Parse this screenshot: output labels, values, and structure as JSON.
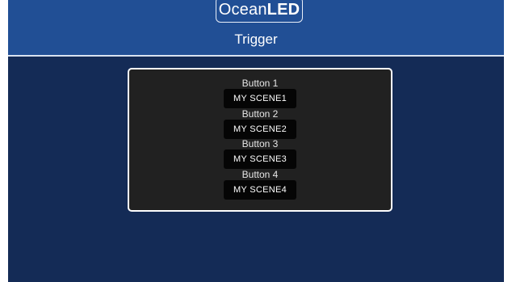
{
  "header": {
    "logo_ocean": "Ocean",
    "logo_led": "LED",
    "title": "Trigger"
  },
  "triggers": [
    {
      "label": "Button 1",
      "scene": "MY SCENE1"
    },
    {
      "label": "Button 2",
      "scene": "MY SCENE2"
    },
    {
      "label": "Button 3",
      "scene": "MY SCENE3"
    },
    {
      "label": "Button 4",
      "scene": "MY SCENE4"
    }
  ],
  "colors": {
    "header_bg": "#214f95",
    "page_bg": "#142b56",
    "panel_bg": "#212121",
    "button_bg": "#050505"
  }
}
